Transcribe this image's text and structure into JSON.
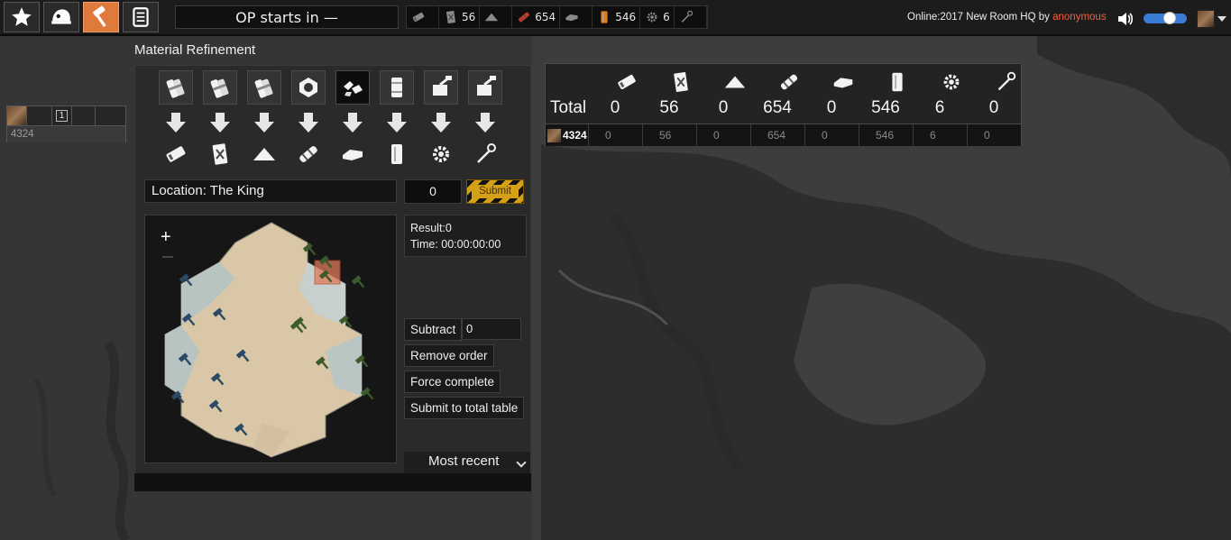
{
  "topbar": {
    "op_status": "OP starts in —",
    "resources": [
      {
        "icon": "bmat-icon",
        "value": ""
      },
      {
        "icon": "salvage-icon",
        "value": "56"
      },
      {
        "icon": "component-icon",
        "value": ""
      },
      {
        "icon": "rmat-icon",
        "value": "654",
        "color": "#c0392b"
      },
      {
        "icon": "sulfur-icon",
        "value": ""
      },
      {
        "icon": "diesel-icon",
        "value": "546",
        "color": "#e07a1f"
      },
      {
        "icon": "gear-icon",
        "value": "6"
      },
      {
        "icon": "wrench-icon",
        "value": ""
      }
    ],
    "online_label": "Online:2017",
    "room_label": "New Room HQ by",
    "username": "anonymous",
    "accent_color": "#e07a3c",
    "user_color": "#ff5a3a"
  },
  "mini_panel": {
    "count": "1",
    "user_id": "4324"
  },
  "refinement": {
    "title": "Material Refinement",
    "location_label": "Location: The King",
    "quantity": "0",
    "submit_label": "Submit",
    "result_label": "Result:0",
    "time_label": "Time: 00:00:00:00",
    "subtract_label": "Subtract",
    "subtract_value": "0",
    "remove_order_label": "Remove order",
    "force_complete_label": "Force complete",
    "submit_total_label": "Submit to total table",
    "sort_selected": "Most recent",
    "zoom_in_label": "+"
  },
  "totals": {
    "label": "Total",
    "values": [
      "0",
      "56",
      "0",
      "654",
      "0",
      "546",
      "6",
      "0"
    ],
    "rows": [
      {
        "user": "4324",
        "values": [
          "0",
          "56",
          "0",
          "654",
          "0",
          "546",
          "6",
          "0"
        ]
      }
    ]
  }
}
